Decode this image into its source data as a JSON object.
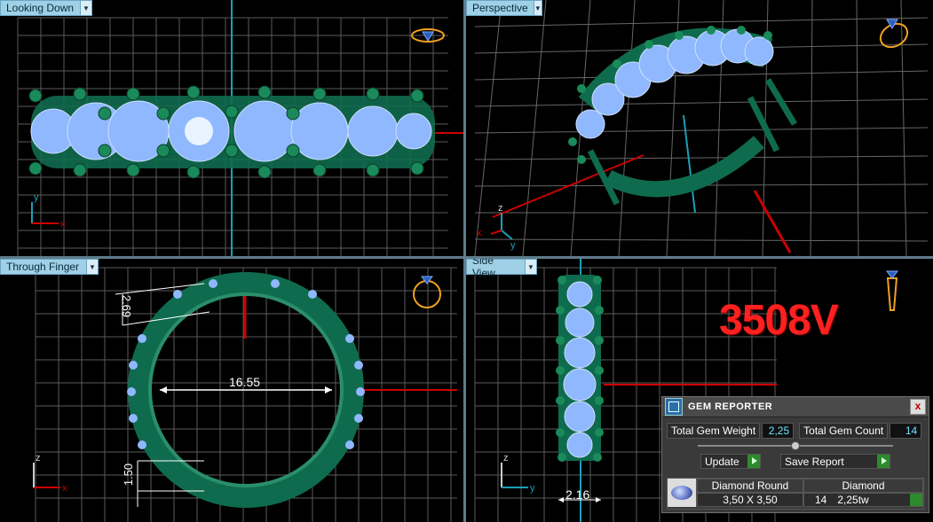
{
  "viewports": {
    "top_left": {
      "label": "Looking Down"
    },
    "top_right": {
      "label": "Perspective"
    },
    "bottom_left": {
      "label": "Through Finger"
    },
    "bottom_right": {
      "label": "Side View"
    }
  },
  "axes": {
    "x": "x",
    "y": "y",
    "z": "z"
  },
  "model_label": "3508V",
  "dimensions": {
    "inner_diameter": "16.55",
    "gem_height": "2.69",
    "shank": "1.50",
    "side_width": "2.16"
  },
  "gem_reporter": {
    "title": "GEM REPORTER",
    "close": "x",
    "total_weight_label": "Total Gem Weight",
    "total_weight_value": "2,25",
    "total_count_label": "Total Gem Count",
    "total_count_value": "14",
    "update_label": "Update",
    "save_report_label": "Save Report",
    "gem": {
      "cut": "Diamond Round",
      "type": "Diamond",
      "size": "3,50 X 3,50",
      "count": "14",
      "weight": "2,25tw"
    }
  },
  "colors": {
    "metal": "#0f6b4e",
    "gem": "#8fb8ff",
    "grid": "#5a5a5a",
    "label": "#ff2020",
    "accent": "#9fd0e6"
  }
}
